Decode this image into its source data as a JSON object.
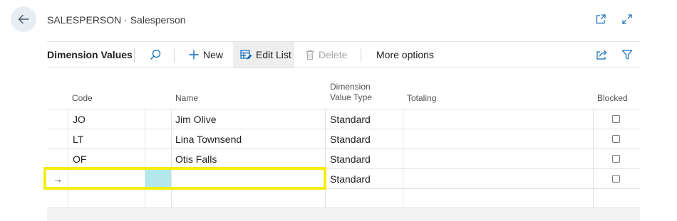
{
  "header": {
    "caption": "SALESPERSON · Salesperson",
    "icons": [
      "back-arrow-icon",
      "open-in-new-window-icon",
      "expand-icon"
    ]
  },
  "actionbar": {
    "title": "Dimension Values",
    "search_icon": "search-icon",
    "new_label": "New",
    "edit_list_label": "Edit List",
    "delete_label": "Delete",
    "more_label": "More options",
    "share_icon": "share-icon",
    "filter_icon": "filter-icon"
  },
  "table": {
    "columns": {
      "code": "Code",
      "name": "Name",
      "dim_type_line1": "Dimension",
      "dim_type_line2": "Value Type",
      "totaling": "Totaling",
      "blocked": "Blocked"
    },
    "rows": [
      {
        "code": "JO",
        "name": "Jim Olive",
        "type": "Standard",
        "totaling": "",
        "blocked": false
      },
      {
        "code": "LT",
        "name": "Lina Townsend",
        "type": "Standard",
        "totaling": "",
        "blocked": false
      },
      {
        "code": "OF",
        "name": "Otis Falls",
        "type": "Standard",
        "totaling": "",
        "blocked": false
      },
      {
        "code": "",
        "name": "",
        "type": "Standard",
        "totaling": "",
        "blocked": false,
        "current_row_marker": "→"
      },
      {
        "code": "",
        "name": "",
        "type": "",
        "totaling": "",
        "blocked": false
      }
    ]
  },
  "colors": {
    "accent": "#0f6cbd",
    "highlight": "#f5ee0c",
    "selected_cell": "#b3e8ea"
  }
}
